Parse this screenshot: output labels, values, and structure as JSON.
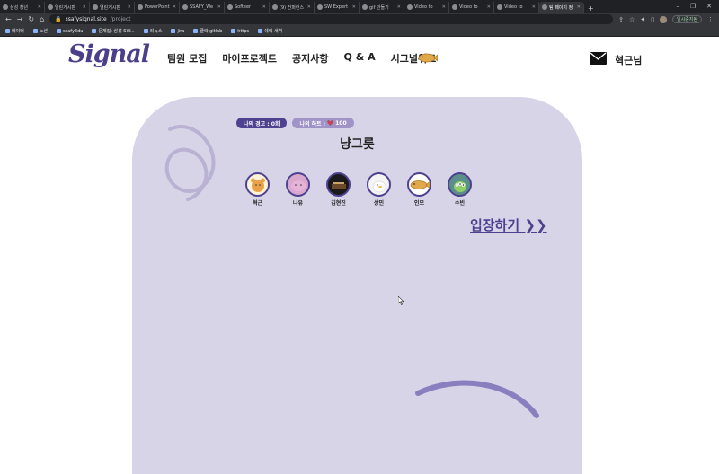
{
  "browser": {
    "tabs": [
      {
        "title": "삼성 청년"
      },
      {
        "title": "열린게시판"
      },
      {
        "title": "열린게시판"
      },
      {
        "title": "PowerPoint"
      },
      {
        "title": "SSAFY_We"
      },
      {
        "title": "Softeer"
      },
      {
        "title": "(9) 컨퍼런스"
      },
      {
        "title": "SW Expert"
      },
      {
        "title": "gif 만들기"
      },
      {
        "title": "Video to"
      },
      {
        "title": "Video to"
      },
      {
        "title": "Video to"
      },
      {
        "title": "팀 페이지 정"
      }
    ],
    "url_host": "ssafysignal.site",
    "url_path": "/project",
    "paused_label": "일시중지됨",
    "bookmarks": [
      {
        "label": "데이터"
      },
      {
        "label": "노션"
      },
      {
        "label": "ssafyEdu"
      },
      {
        "label": "문제집: 삼성 SW..."
      },
      {
        "label": "리눅스"
      },
      {
        "label": "jira"
      },
      {
        "label": "클락 gitlab"
      },
      {
        "label": "https"
      },
      {
        "label": "쉐릭 세벽"
      }
    ]
  },
  "site": {
    "logo": "Signal",
    "nav": [
      "팀원 모집",
      "마이프로젝트",
      "공지사항",
      "Q & A",
      "시그널위크"
    ],
    "user": "혁근님"
  },
  "team": {
    "warning_label": "나의 경고 : 0회",
    "heart_label": "나의 하트 :",
    "heart_count": "100",
    "name": "냥그릇",
    "members": [
      {
        "name": "혁근"
      },
      {
        "name": "나유"
      },
      {
        "name": "김현진"
      },
      {
        "name": "상민"
      },
      {
        "name": "인모"
      },
      {
        "name": "수빈"
      }
    ],
    "enter_label": "입장하기 ❯❯"
  },
  "colors": {
    "brand": "#4e418f",
    "card": "#d8d4e8",
    "heart_badge": "#9f93c8"
  }
}
